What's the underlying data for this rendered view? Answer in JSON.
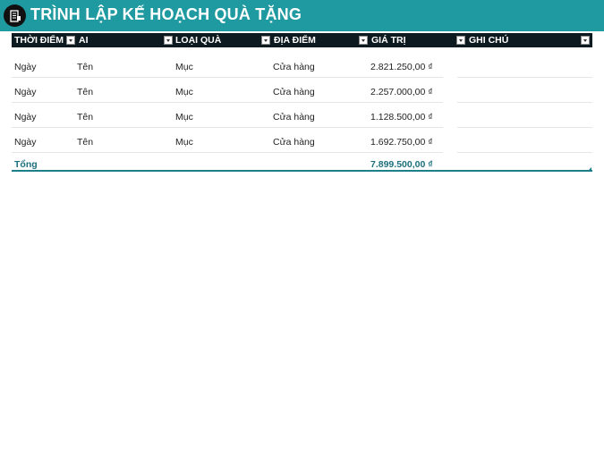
{
  "title": "TRÌNH LẬP KẾ HOẠCH QUÀ TẶNG",
  "columns": [
    {
      "label": "THỜI ĐIỂM"
    },
    {
      "label": "AI"
    },
    {
      "label": "LOẠI QUÀ"
    },
    {
      "label": "ĐỊA ĐIỂM"
    },
    {
      "label": "GIÁ TRỊ"
    },
    {
      "label": "GHI CHÚ"
    }
  ],
  "rows": [
    {
      "time": "Ngày",
      "who": "Tên",
      "type": "Mục",
      "place": "Cửa hàng",
      "value": "2.821.250,00 ₫",
      "note": ""
    },
    {
      "time": "Ngày",
      "who": "Tên",
      "type": "Mục",
      "place": "Cửa hàng",
      "value": "2.257.000,00 ₫",
      "note": ""
    },
    {
      "time": "Ngày",
      "who": "Tên",
      "type": "Mục",
      "place": "Cửa hàng",
      "value": "1.128.500,00 ₫",
      "note": ""
    },
    {
      "time": "Ngày",
      "who": "Tên",
      "type": "Mục",
      "place": "Cửa hàng",
      "value": "1.692.750,00 ₫",
      "note": ""
    }
  ],
  "total": {
    "label": "Tổng",
    "value": "7.899.500,00 ₫"
  },
  "colors": {
    "title_bar": "#1f9aa0",
    "header_bg": "#0d1a1f",
    "total_text": "#1d6f7e"
  },
  "icons": {
    "title": "gift-list-icon",
    "filter": "dropdown-filter-icon"
  }
}
